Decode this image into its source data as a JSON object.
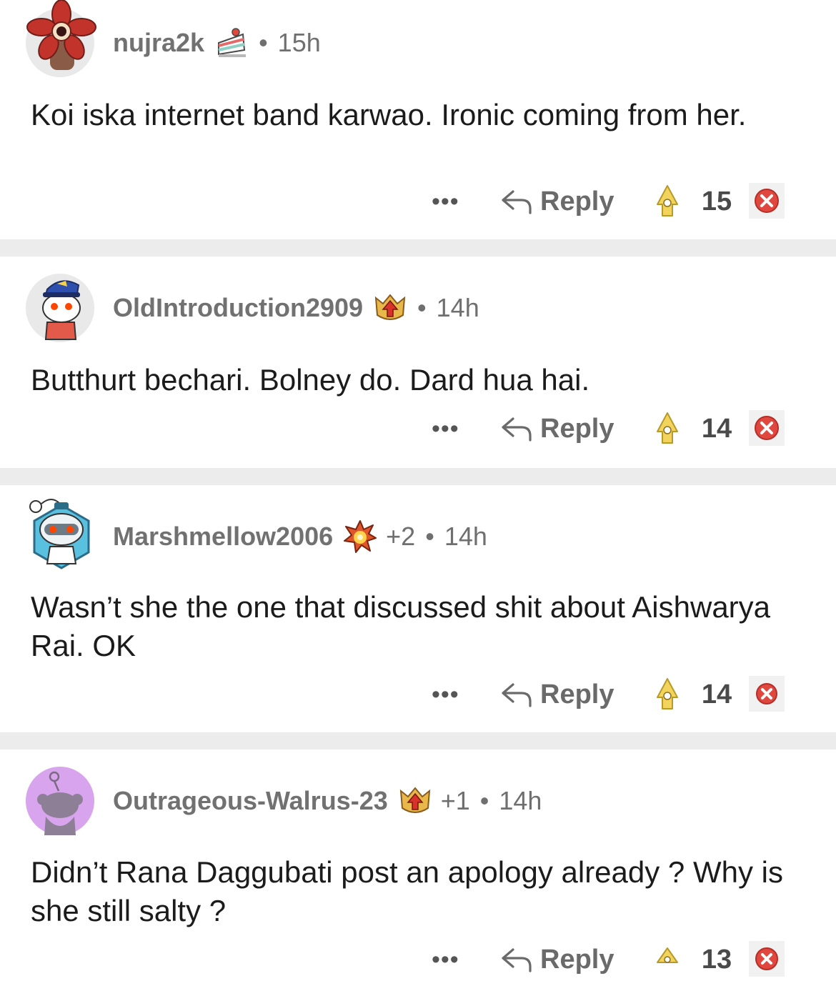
{
  "comments": [
    {
      "username": "nujra2k",
      "flair_icon": "cake-icon",
      "extra": "",
      "time": "15h",
      "text": "Koi iska internet band karwao. Ironic coming from her.",
      "more": "•••",
      "reply_label": "Reply",
      "score": "15"
    },
    {
      "username": "OldIntroduction2909",
      "flair_icon": "upvote-shield-icon",
      "extra": "",
      "time": "14h",
      "text": "Butthurt bechari. Bolney do. Dard hua hai.",
      "more": "•••",
      "reply_label": "Reply",
      "score": "14"
    },
    {
      "username": "Marshmellow2006",
      "flair_icon": "explosion-award-icon",
      "extra": "+2",
      "time": "14h",
      "text": "Wasn’t she the one that discussed shit about Aishwarya Rai. OK",
      "more": "•••",
      "reply_label": "Reply",
      "score": "14"
    },
    {
      "username": "Outrageous-Walrus-23",
      "flair_icon": "upvote-shield-icon",
      "extra": "+1",
      "time": "14h",
      "text": "Didn’t Rana Daggubati post an apology already ? Why is she still salty ?",
      "more": "•••",
      "reply_label": "Reply",
      "score": "13"
    }
  ],
  "separator": "•",
  "colors": {
    "divider": "#ececec",
    "downvote": "#e0473e",
    "upvote_fill": "#f2d45c"
  }
}
